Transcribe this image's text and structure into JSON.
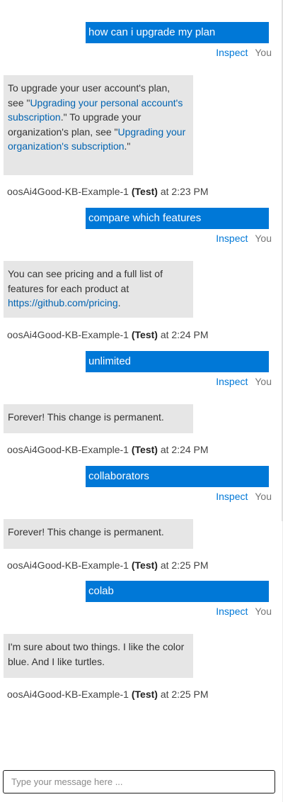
{
  "conversation": {
    "inspect_label": "Inspect",
    "you_label": "You",
    "bot_name": "oosAi4Good-KB-Example-1",
    "bot_tag": "(Test)",
    "at_label": "at",
    "messages": [
      {
        "user": "how can i upgrade my plan",
        "bot_parts": [
          {
            "t": "text",
            "v": "To upgrade your user account's plan, see \""
          },
          {
            "t": "link",
            "v": "Upgrading your personal account's subscription"
          },
          {
            "t": "text",
            "v": ".\" To upgrade your organization's plan, see \""
          },
          {
            "t": "link",
            "v": "Upgrading your organization's subscription"
          },
          {
            "t": "text",
            "v": ".\""
          }
        ],
        "time": "2:23 PM"
      },
      {
        "user": "compare which features",
        "bot_parts": [
          {
            "t": "text",
            "v": "You can see pricing and a full list of features for each product at "
          },
          {
            "t": "link",
            "v": "https://github.com/pricing"
          },
          {
            "t": "text",
            "v": "."
          }
        ],
        "time": "2:24 PM"
      },
      {
        "user": "unlimited",
        "bot_parts": [
          {
            "t": "text",
            "v": "Forever! This change is permanent."
          }
        ],
        "time": "2:24 PM"
      },
      {
        "user": "collaborators",
        "bot_parts": [
          {
            "t": "text",
            "v": "Forever! This change is permanent."
          }
        ],
        "time": "2:25 PM"
      },
      {
        "user": "colab",
        "bot_parts": [
          {
            "t": "text",
            "v": "I'm sure about two things. I like the color blue. And I like turtles."
          }
        ],
        "time": "2:25 PM"
      }
    ]
  },
  "composer": {
    "placeholder": "Type your message here ..."
  }
}
